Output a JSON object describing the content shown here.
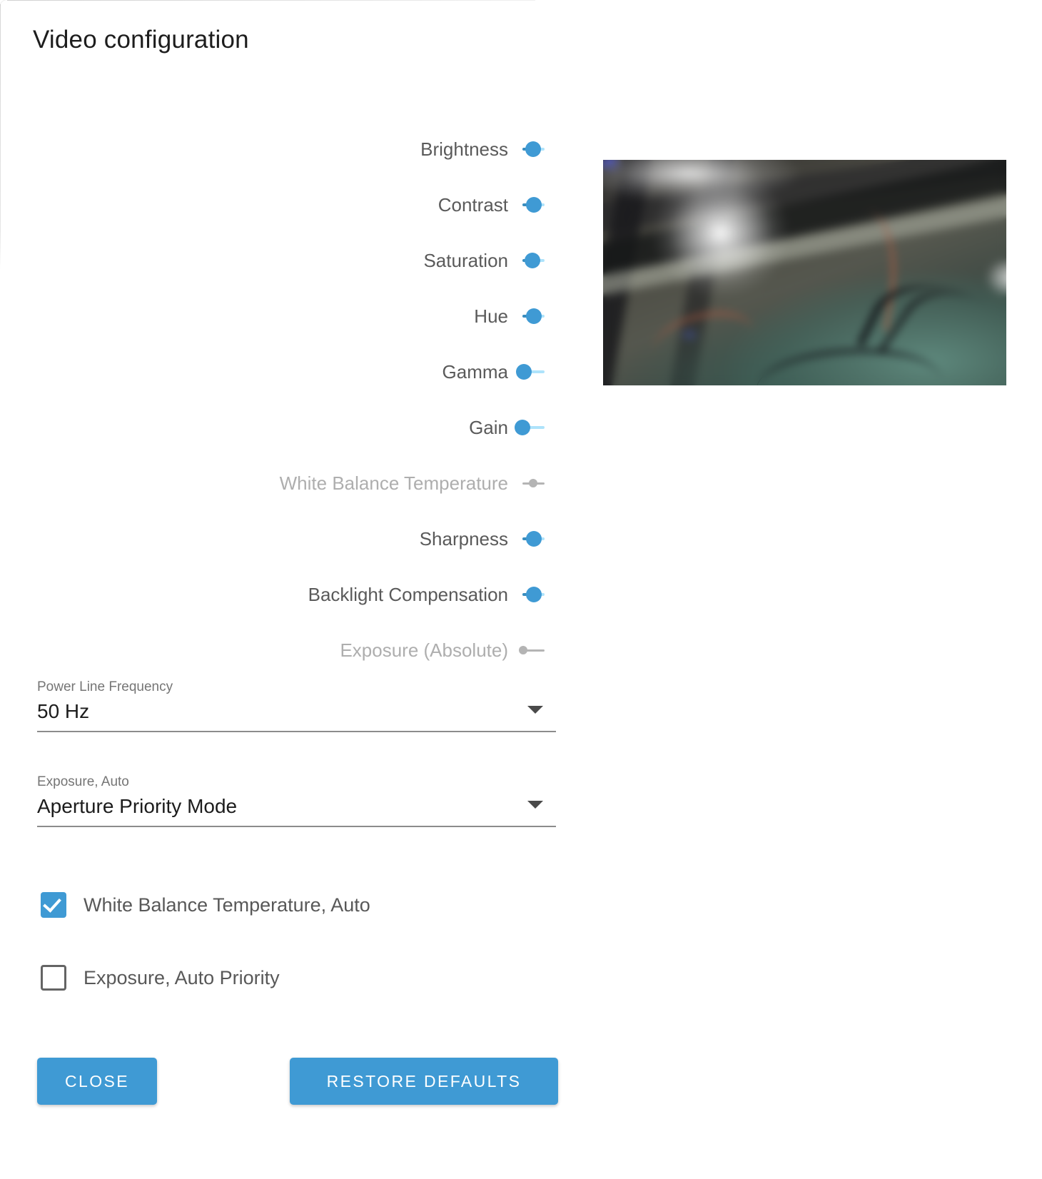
{
  "dialog": {
    "title": "Video configuration"
  },
  "sliders": [
    {
      "label": "Brightness",
      "fill_pct": 49,
      "enabled": true
    },
    {
      "label": "Contrast",
      "fill_pct": 50,
      "enabled": true
    },
    {
      "label": "Saturation",
      "fill_pct": 44,
      "enabled": true
    },
    {
      "label": "Hue",
      "fill_pct": 50,
      "enabled": true
    },
    {
      "label": "Gamma",
      "fill_pct": 5,
      "enabled": true
    },
    {
      "label": "Gain",
      "fill_pct": 0,
      "enabled": true
    },
    {
      "label": "White Balance Temperature",
      "fill_pct": 47,
      "enabled": false
    },
    {
      "label": "Sharpness",
      "fill_pct": 50,
      "enabled": true
    },
    {
      "label": "Backlight Compensation",
      "fill_pct": 50,
      "enabled": true
    },
    {
      "label": "Exposure (Absolute)",
      "fill_pct": 2,
      "enabled": false
    }
  ],
  "selects": [
    {
      "caption": "Power Line Frequency",
      "value": "50 Hz",
      "arrow_icon": "chevron-down-icon"
    },
    {
      "caption": "Exposure, Auto",
      "value": "Aperture Priority Mode",
      "arrow_icon": "chevron-down-icon"
    }
  ],
  "checkboxes": [
    {
      "label": "White Balance Temperature, Auto",
      "checked": true
    },
    {
      "label": "Exposure, Auto Priority",
      "checked": false
    }
  ],
  "buttons": {
    "close": "CLOSE",
    "restore_defaults": "RESTORE DEFAULTS"
  },
  "colors": {
    "accent": "#3f9ad4",
    "slider_fill": "#3a8dbe",
    "slider_rest": "#aee3fb",
    "disabled": "#b4b4b4",
    "label": "#5a5a5a",
    "label_disabled": "#aeaeae"
  },
  "video_preview": {
    "description": "Live camera preview: blurry low-light view of machinery with dark wires, a bright white light glare at upper left, and teal-green surfaces in the lower right."
  }
}
